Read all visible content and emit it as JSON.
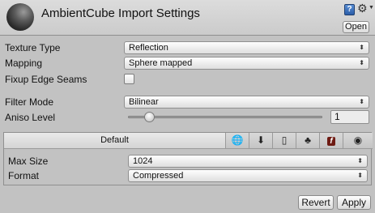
{
  "header": {
    "title": "AmbientCube Import Settings",
    "open_label": "Open",
    "help_glyph": "?"
  },
  "settings": {
    "texture_type_label": "Texture Type",
    "texture_type_value": "Reflection",
    "mapping_label": "Mapping",
    "mapping_value": "Sphere mapped",
    "fixup_label": "Fixup Edge Seams",
    "fixup_checked": false,
    "filter_mode_label": "Filter Mode",
    "filter_mode_value": "Bilinear",
    "aniso_label": "Aniso Level",
    "aniso_value": "1"
  },
  "platforms": {
    "default_tab": "Default",
    "tabs": [
      {
        "name": "web",
        "icon": "globe-icon"
      },
      {
        "name": "standalone",
        "icon": "download-icon"
      },
      {
        "name": "ios",
        "icon": "phone-icon"
      },
      {
        "name": "android",
        "icon": "android-icon"
      },
      {
        "name": "flash",
        "icon": "flash-icon"
      },
      {
        "name": "other",
        "icon": "circle-icon"
      }
    ],
    "max_size_label": "Max Size",
    "max_size_value": "1024",
    "format_label": "Format",
    "format_value": "Compressed"
  },
  "footer": {
    "revert_label": "Revert",
    "apply_label": "Apply"
  }
}
